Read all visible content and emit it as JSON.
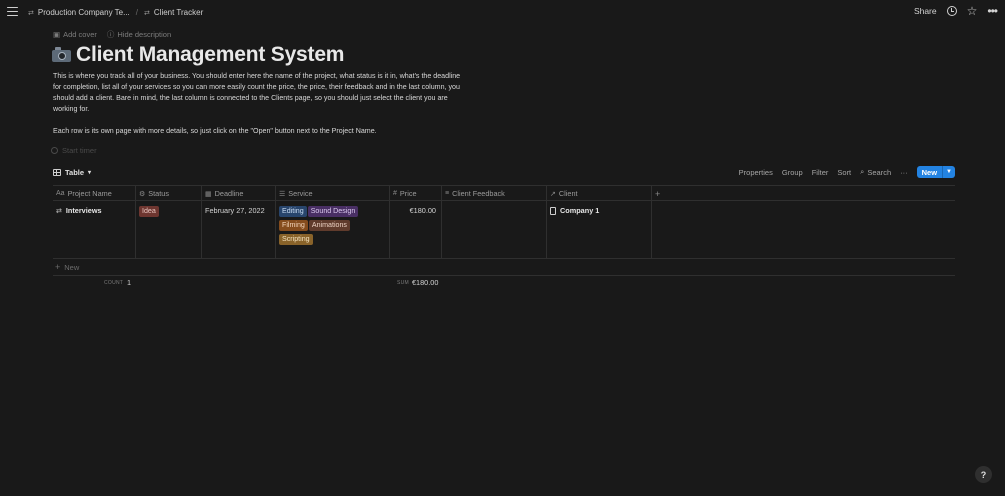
{
  "topbar": {
    "breadcrumbs": [
      {
        "label": "Production Company Te..."
      },
      {
        "label": "Client Tracker"
      }
    ],
    "share_label": "Share"
  },
  "page": {
    "add_cover": "Add cover",
    "hide_description": "Hide description",
    "title": "Client Management System",
    "icon": "camera-icon",
    "description_1": "This is where you track all of your business. You should enter here the name of the project, what status is it in, what's the deadline for completion, list all of your services so you can more easily count the price, the price, their feedback and in the last column, you should add a client. Bare in mind, the last column is connected to the Clients page, so you should just select the client you are working for.",
    "description_2": "Each row is its own page with more details, so just click on the \"Open\" button next to the Project Name.",
    "start_timer": "Start timer"
  },
  "view": {
    "tab_label": "Table",
    "tools": [
      "Properties",
      "Group",
      "Filter",
      "Sort",
      "Search"
    ],
    "more": "···",
    "new_label": "New"
  },
  "table": {
    "columns": [
      {
        "label": "Project Name",
        "icon": "Aa"
      },
      {
        "label": "Status",
        "icon": "⚙"
      },
      {
        "label": "Deadline",
        "icon": "▦"
      },
      {
        "label": "Service",
        "icon": "☰"
      },
      {
        "label": "Price",
        "icon": "#"
      },
      {
        "label": "Client Feedback",
        "icon": "≡"
      },
      {
        "label": "Client",
        "icon": "↗"
      }
    ],
    "add_column": "+",
    "rows": [
      {
        "name": "Interviews",
        "status": "Idea",
        "deadline": "February 27, 2022",
        "services": [
          "Editing",
          "Sound Design",
          "Filming",
          "Animations",
          "Scripting"
        ],
        "price": "€180.00",
        "feedback": "",
        "client": "Company 1"
      }
    ],
    "new_row": "New",
    "count_label": "COUNT",
    "count_value": "1",
    "sum_label": "SUM",
    "sum_value": "€180.00"
  },
  "colors": {
    "idea": "#6e3630",
    "editing": "#28456c",
    "sound_design": "#492f64",
    "filming": "#854c1d",
    "animations": "#603b2c",
    "scripting": "#89632a",
    "accent": "#2383e2"
  },
  "help": "?"
}
